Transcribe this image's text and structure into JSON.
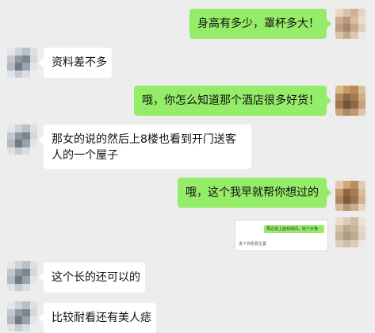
{
  "messages": [
    {
      "side": "out",
      "text": "身高有多少，罩杯多大！"
    },
    {
      "side": "in",
      "text": "资料差不多"
    },
    {
      "side": "out",
      "text": "哦，你怎么知道那个酒店很多好货！"
    },
    {
      "side": "in",
      "text": "那女的说的然后上8楼也看到开门送客人的一个屋子"
    },
    {
      "side": "out",
      "text": "哦，这个我早就帮你想过的"
    },
    {
      "side": "in",
      "text": "这个长的还可以的"
    },
    {
      "side": "in",
      "text": "比较耐看还有美人痣"
    }
  ],
  "quoted_screenshot": {
    "bubble_text": "那边说上面有房间，给个价格",
    "caption_text": "发个你看看位置"
  },
  "colors": {
    "background": "#ededed",
    "incoming_bubble": "#ffffff",
    "outgoing_bubble": "#95ec69"
  }
}
